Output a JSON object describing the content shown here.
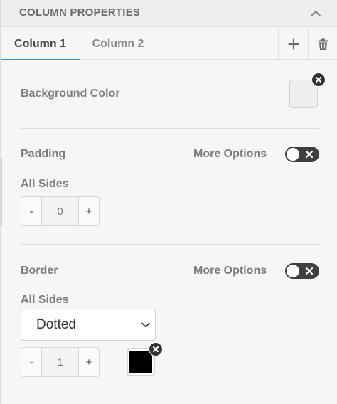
{
  "header": {
    "title": "COLUMN PROPERTIES",
    "collapse_icon": "chevron-up-icon"
  },
  "tabs": [
    {
      "label": "Column 1",
      "active": true
    },
    {
      "label": "Column 2",
      "active": false
    }
  ],
  "tab_actions": {
    "add_icon": "plus-icon",
    "delete_icon": "trash-icon"
  },
  "background": {
    "label": "Background Color",
    "color": "#eef0f0"
  },
  "padding": {
    "label": "Padding",
    "more_options_label": "More Options",
    "more_options_on": false,
    "all_sides_label": "All Sides",
    "minus": "-",
    "value": "0",
    "plus": "+"
  },
  "border": {
    "label": "Border",
    "more_options_label": "More Options",
    "more_options_on": false,
    "all_sides_label": "All Sides",
    "style_value": "Dotted",
    "minus": "-",
    "width_value": "1",
    "plus": "+",
    "color": "#000000"
  },
  "colors": {
    "accent": "#3b8ed8",
    "toggle_bg": "#3f3f3f"
  }
}
